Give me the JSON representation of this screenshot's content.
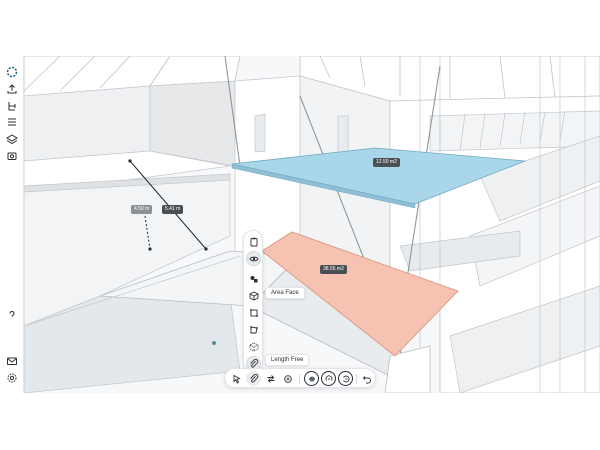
{
  "measurements": {
    "area_top": "12.50 m2",
    "area_bottom": "38.55 m2",
    "length_a": "4.50 m",
    "length_b": "5.41 m"
  },
  "tooltips": {
    "area_face": "Area Face",
    "length_free": "Length Free"
  },
  "colors": {
    "area_top_fill": "#a9d6e8",
    "area_bottom_fill": "#f6c2b2",
    "label_bg": "#4a4f55",
    "label_gray": "#8a9096",
    "accent": "#1f2a36"
  },
  "left_rail_icons": [
    "app-logo-icon",
    "upload-icon",
    "hierarchy-icon",
    "list-icon",
    "layers-icon",
    "camera-icon",
    "help-icon",
    "mail-icon",
    "settings-icon"
  ],
  "tool_strip_icons": [
    "clipboard-icon",
    "eye-icon",
    "shapes-icon",
    "area-face-icon",
    "area-rect-icon",
    "area-polygon-icon",
    "volume-icon",
    "length-free-icon"
  ],
  "bottom_toolbar_icons": [
    "select-cursor-icon",
    "measure-icon",
    "move-icon",
    "rotate-icon",
    "view-top-icon",
    "view-orbit-icon",
    "view-reset-icon",
    "undo-icon"
  ]
}
